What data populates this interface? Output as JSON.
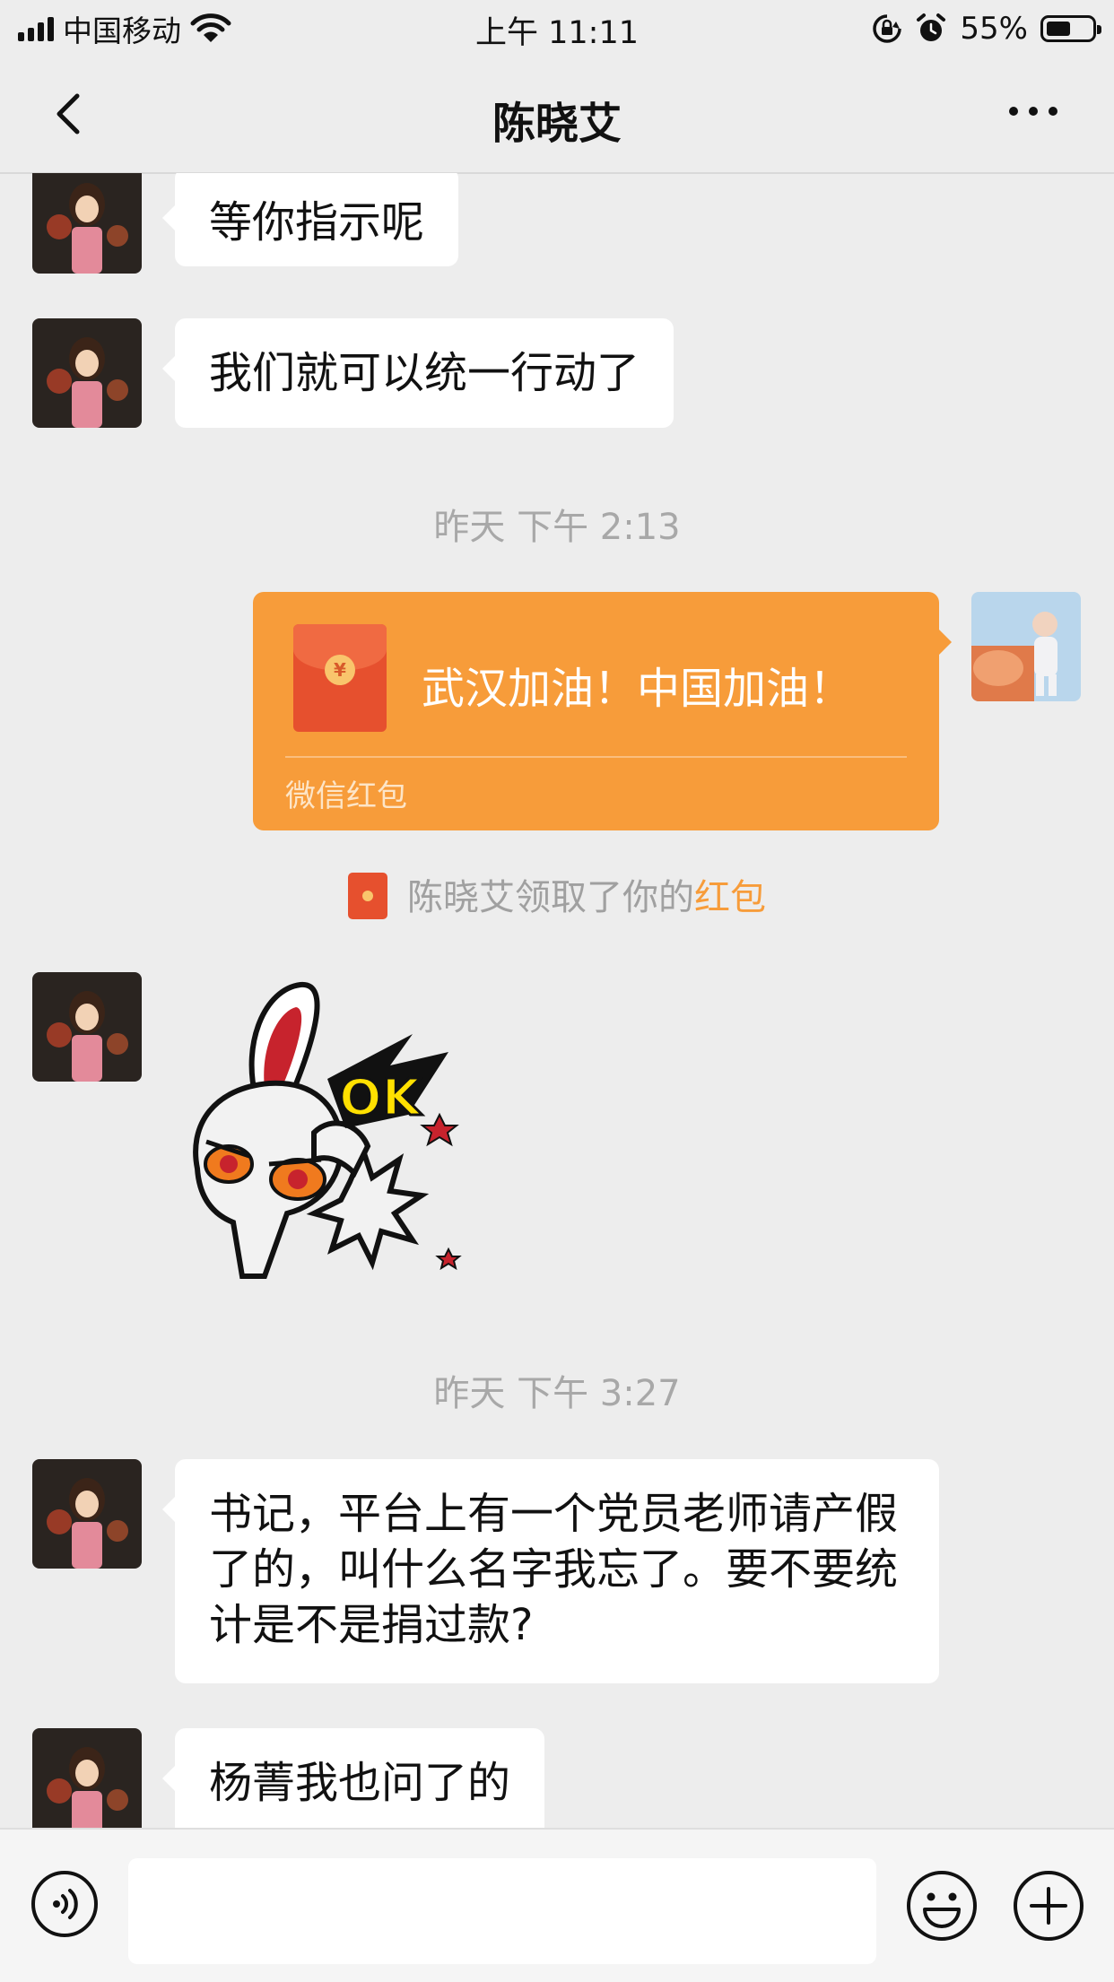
{
  "status_bar": {
    "carrier": "中国移动",
    "time": "上午 11:11",
    "battery": "55%",
    "battery_level": 0.55
  },
  "nav": {
    "title": "陈晓艾"
  },
  "messages": {
    "m1": "等你指示呢",
    "m2": "我们就可以统一行动了",
    "time1": "昨天 下午 2:13",
    "red_packet": {
      "greeting": "武汉加油！中国加油！",
      "label": "微信红包"
    },
    "notice": {
      "text": "陈晓艾领取了你的",
      "highlight": "红包"
    },
    "sticker": {
      "text": "OK"
    },
    "time2": "昨天 下午 3:27",
    "m3": "书记，平台上有一个党员老师请产假了的，叫什么名字我忘了。要不要统计是不是捐过款?",
    "m4": "杨菁我也问了的"
  },
  "input": {
    "value": ""
  },
  "colors": {
    "background": "#ededed",
    "red_packet": "#f79c3a",
    "highlight": "#f79c3a",
    "bubble": "#ffffff"
  },
  "icons": [
    "back-icon",
    "more-icon",
    "voice-icon",
    "emoji-icon",
    "plus-icon",
    "wifi-icon",
    "lock-rotation-icon",
    "alarm-icon",
    "battery-icon"
  ]
}
